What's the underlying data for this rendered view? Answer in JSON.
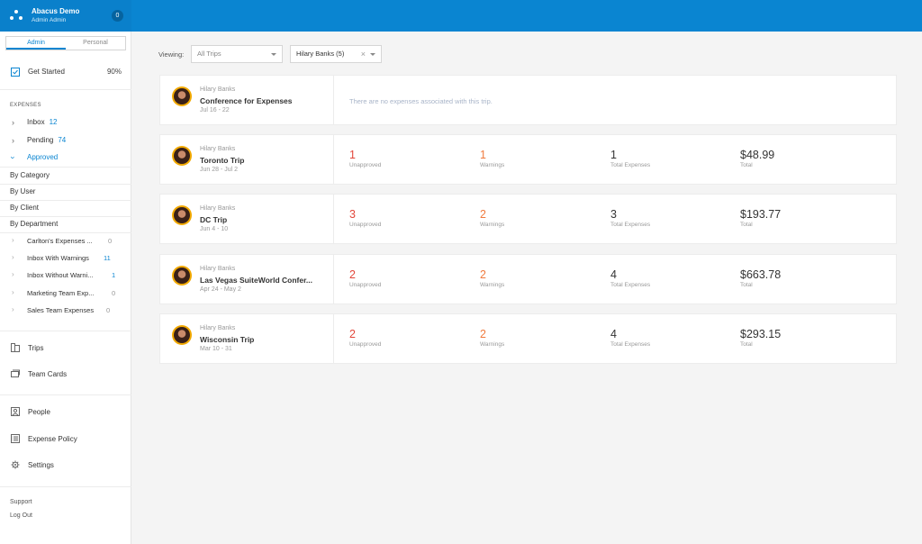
{
  "org": {
    "name": "Abacus Demo",
    "role": "Admin Admin",
    "notifications": "0"
  },
  "toggle": {
    "admin": "Admin",
    "personal": "Personal"
  },
  "sidebar": {
    "get_started": {
      "label": "Get Started",
      "percent": "90%"
    },
    "section_label": "EXPENSES",
    "inbox": {
      "label": "Inbox",
      "count": "12"
    },
    "pending": {
      "label": "Pending",
      "count": "74"
    },
    "approved": {
      "label": "Approved"
    },
    "filters": [
      "By Category",
      "By User",
      "By Client",
      "By Department"
    ],
    "saved_reports": [
      {
        "name": "Carlton's Expenses ...",
        "count": "0",
        "count_color": "grey"
      },
      {
        "name": "Inbox With Warnings",
        "count": "11",
        "count_color": "blue"
      },
      {
        "name": "Inbox Without Warni...",
        "count": "1",
        "count_color": "blue"
      },
      {
        "name": "Marketing Team Exp...",
        "count": "0",
        "count_color": "grey"
      },
      {
        "name": "Sales Team Expenses",
        "count": "0",
        "count_color": "grey"
      }
    ],
    "trips": "Trips",
    "team_cards": "Team Cards",
    "people": "People",
    "expense_policy": "Expense Policy",
    "settings": "Settings",
    "support": "Support",
    "logout": "Log Out"
  },
  "filter_bar": {
    "viewing_label": "Viewing:",
    "trip_filter": "All Trips",
    "user_filter": "Hilary Banks (5)",
    "clear_icon": "×"
  },
  "trips": [
    {
      "owner": "Hilary Banks",
      "name": "Conference for Expenses",
      "dates": "Jul 16 - 22",
      "empty_text": "There are no expenses associated with this trip."
    },
    {
      "owner": "Hilary Banks",
      "name": "Toronto Trip",
      "dates": "Jun 28 - Jul 2",
      "unapproved": "1",
      "warnings": "1",
      "total_expenses": "1",
      "total": "$48.99"
    },
    {
      "owner": "Hilary Banks",
      "name": "DC Trip",
      "dates": "Jun 4 - 10",
      "unapproved": "3",
      "warnings": "2",
      "total_expenses": "3",
      "total": "$193.77"
    },
    {
      "owner": "Hilary Banks",
      "name": "Las Vegas SuiteWorld Confer...",
      "dates": "Apr 24 - May 2",
      "unapproved": "2",
      "warnings": "2",
      "total_expenses": "4",
      "total": "$663.78"
    },
    {
      "owner": "Hilary Banks",
      "name": "Wisconsin Trip",
      "dates": "Mar 10 - 31",
      "unapproved": "2",
      "warnings": "2",
      "total_expenses": "4",
      "total": "$293.15"
    }
  ],
  "stat_labels": {
    "unapproved": "Unapproved",
    "warnings": "Warnings",
    "total_expenses": "Total Expenses",
    "total": "Total"
  }
}
